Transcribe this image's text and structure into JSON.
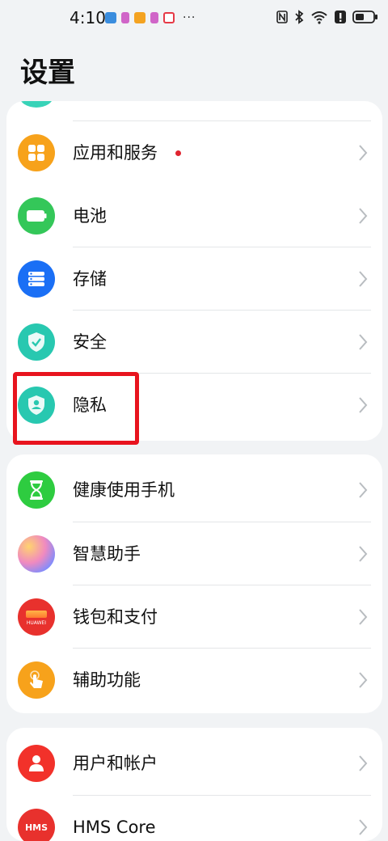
{
  "status_bar": {
    "time": "4:10",
    "more": "···",
    "notif_colors": [
      "#3a8dde",
      "#d065c8",
      "#f4a321",
      "#d065c8",
      "#e63946"
    ]
  },
  "page_title": "设置",
  "groups": [
    {
      "items": [
        {
          "label": "应用和服务",
          "icon": "apps-icon",
          "color": "#f7a21b",
          "badge": true
        },
        {
          "label": "电池",
          "icon": "battery-icon",
          "color": "#34c759"
        },
        {
          "label": "存储",
          "icon": "storage-icon",
          "color": "#1a6ff5"
        },
        {
          "label": "安全",
          "icon": "shield-check-icon",
          "color": "#28c8b0"
        },
        {
          "label": "隐私",
          "icon": "privacy-shield-icon",
          "color": "#28c8b0",
          "highlighted": true
        }
      ]
    },
    {
      "items": [
        {
          "label": "健康使用手机",
          "icon": "hourglass-icon",
          "color": "#2ecc40"
        },
        {
          "label": "智慧助手",
          "icon": "assistant-orb-icon",
          "color": "#f08ac0"
        },
        {
          "label": "钱包和支付",
          "icon": "wallet-icon",
          "color": "#e8312d",
          "icon_text": "HUAWEI"
        },
        {
          "label": "辅助功能",
          "icon": "accessibility-hand-icon",
          "color": "#f7a21b"
        }
      ]
    },
    {
      "items": [
        {
          "label": "用户和帐户",
          "icon": "user-icon",
          "color": "#f2312a"
        },
        {
          "label": "HMS Core",
          "icon": "hms-core-icon",
          "color": "#e8312d",
          "icon_text": "HMS"
        }
      ]
    }
  ]
}
